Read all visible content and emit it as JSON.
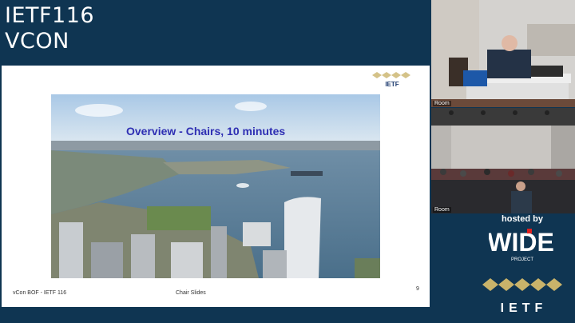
{
  "header": {
    "line1": "IETF116",
    "line2": "VCON"
  },
  "slide": {
    "heading": "Overview - Chairs, 10 minutes",
    "footer_left": "vCon BOF - IETF 116",
    "footer_center": "Chair Slides",
    "page_number": "9",
    "logo_text": "IETF"
  },
  "cameras": [
    {
      "label": "Room"
    },
    {
      "label": "Room"
    }
  ],
  "sponsor": {
    "hosted_by": "hosted by",
    "name": "WIDE",
    "subtitle": "PROJECT",
    "ietf": "IETF"
  },
  "colors": {
    "background": "#0f3552",
    "slide_heading": "#2f2fb3",
    "wide_red": "#e02020"
  }
}
